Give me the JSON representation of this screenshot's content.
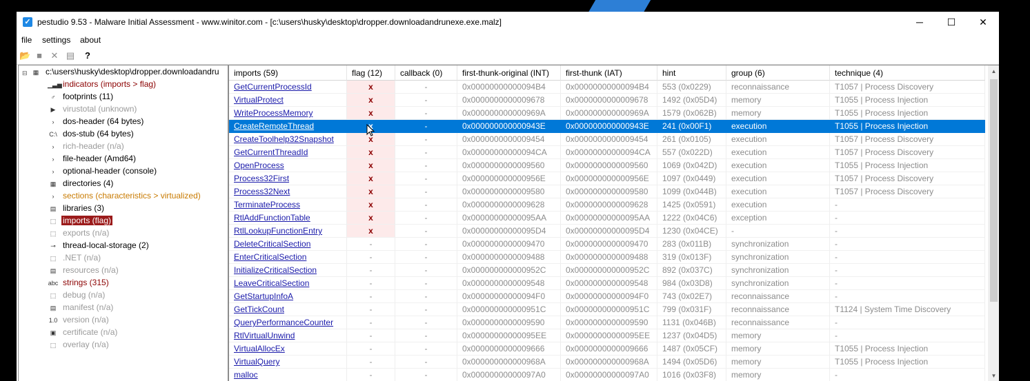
{
  "window": {
    "title": "pestudio 9.53 - Malware Initial Assessment - www.winitor.com - [c:\\users\\husky\\desktop\\dropper.downloadandrunexe.exe.malz]",
    "minimize": "─",
    "maximize": "☐",
    "close": "✕"
  },
  "menu": [
    "file",
    "settings",
    "about"
  ],
  "toolbar": {
    "open_icon": "folder-open-icon",
    "save_icon": "save-icon",
    "close_icon": "close-file-icon",
    "list_icon": "list-icon",
    "help_icon": "help-icon"
  },
  "tree": {
    "root": "c:\\users\\husky\\desktop\\dropper.downloadandru",
    "items": [
      {
        "label": "indicators (imports > flag)",
        "color": "#8b0000",
        "icon": "indicators-icon"
      },
      {
        "label": "footprints (11)",
        "color": "#000000",
        "icon": "footprints-icon"
      },
      {
        "label": "virustotal (unknown)",
        "color": "#9a9a9a",
        "icon": "virustotal-icon"
      },
      {
        "label": "dos-header (64 bytes)",
        "color": "#000000",
        "icon": "expand-arrow-icon"
      },
      {
        "label": "dos-stub (64 bytes)",
        "color": "#000000",
        "icon": "console-icon"
      },
      {
        "label": "rich-header (n/a)",
        "color": "#9a9a9a",
        "icon": "expand-arrow-icon"
      },
      {
        "label": "file-header (Amd64)",
        "color": "#000000",
        "icon": "expand-arrow-icon"
      },
      {
        "label": "optional-header (console)",
        "color": "#000000",
        "icon": "expand-arrow-icon"
      },
      {
        "label": "directories (4)",
        "color": "#000000",
        "icon": "directories-icon"
      },
      {
        "label": "sections (characteristics > virtualized)",
        "color": "#c87a00",
        "icon": "expand-arrow-icon"
      },
      {
        "label": "libraries (3)",
        "color": "#000000",
        "icon": "libraries-icon"
      },
      {
        "label": "imports (flag)",
        "color": "#ffffff",
        "icon": "imports-icon"
      },
      {
        "label": "exports (n/a)",
        "color": "#9a9a9a",
        "icon": "exports-icon"
      },
      {
        "label": "thread-local-storage (2)",
        "color": "#000000",
        "icon": "tls-icon"
      },
      {
        "label": ".NET (n/a)",
        "color": "#9a9a9a",
        "icon": "dotnet-icon"
      },
      {
        "label": "resources (n/a)",
        "color": "#9a9a9a",
        "icon": "resources-icon"
      },
      {
        "label": "strings (315)",
        "color": "#8b0000",
        "icon": "strings-icon"
      },
      {
        "label": "debug (n/a)",
        "color": "#9a9a9a",
        "icon": "debug-icon"
      },
      {
        "label": "manifest (n/a)",
        "color": "#9a9a9a",
        "icon": "manifest-icon"
      },
      {
        "label": "version (n/a)",
        "color": "#9a9a9a",
        "icon": "version-icon"
      },
      {
        "label": "certificate (n/a)",
        "color": "#9a9a9a",
        "icon": "certificate-icon"
      },
      {
        "label": "overlay (n/a)",
        "color": "#9a9a9a",
        "icon": "overlay-icon"
      }
    ]
  },
  "imports": {
    "columns": [
      "imports (59)",
      "flag (12)",
      "callback (0)",
      "first-thunk-original (INT)",
      "first-thunk (IAT)",
      "hint",
      "group (6)",
      "technique (4)"
    ],
    "rows": [
      [
        "GetCurrentProcessId",
        "x",
        "-",
        "0x00000000000094B4",
        "0x00000000000094B4",
        "553 (0x0229)",
        "reconnaissance",
        "T1057 | Process Discovery"
      ],
      [
        "VirtualProtect",
        "x",
        "-",
        "0x0000000000009678",
        "0x0000000000009678",
        "1492 (0x05D4)",
        "memory",
        "T1055 | Process Injection"
      ],
      [
        "WriteProcessMemory",
        "x",
        "-",
        "0x000000000000969A",
        "0x000000000000969A",
        "1579 (0x062B)",
        "memory",
        "T1055 | Process Injection"
      ],
      [
        "CreateRemoteThread",
        "x",
        "-",
        "0x000000000000943E",
        "0x000000000000943E",
        "241 (0x00F1)",
        "execution",
        "T1055 | Process Injection"
      ],
      [
        "CreateToolhelp32Snapshot",
        "x",
        "-",
        "0x0000000000009454",
        "0x0000000000009454",
        "261 (0x0105)",
        "execution",
        "T1057 | Process Discovery"
      ],
      [
        "GetCurrentThreadId",
        "x",
        "-",
        "0x00000000000094CA",
        "0x00000000000094CA",
        "557 (0x022D)",
        "execution",
        "T1057 | Process Discovery"
      ],
      [
        "OpenProcess",
        "x",
        "-",
        "0x0000000000009560",
        "0x0000000000009560",
        "1069 (0x042D)",
        "execution",
        "T1055 | Process Injection"
      ],
      [
        "Process32First",
        "x",
        "-",
        "0x000000000000956E",
        "0x000000000000956E",
        "1097 (0x0449)",
        "execution",
        "T1057 | Process Discovery"
      ],
      [
        "Process32Next",
        "x",
        "-",
        "0x0000000000009580",
        "0x0000000000009580",
        "1099 (0x044B)",
        "execution",
        "T1057 | Process Discovery"
      ],
      [
        "TerminateProcess",
        "x",
        "-",
        "0x0000000000009628",
        "0x0000000000009628",
        "1425 (0x0591)",
        "execution",
        "-"
      ],
      [
        "RtlAddFunctionTable",
        "x",
        "-",
        "0x00000000000095AA",
        "0x00000000000095AA",
        "1222 (0x04C6)",
        "exception",
        "-"
      ],
      [
        "RtlLookupFunctionEntry",
        "x",
        "-",
        "0x00000000000095D4",
        "0x00000000000095D4",
        "1230 (0x04CE)",
        "-",
        "-"
      ],
      [
        "DeleteCriticalSection",
        "-",
        "-",
        "0x0000000000009470",
        "0x0000000000009470",
        "283 (0x011B)",
        "synchronization",
        "-"
      ],
      [
        "EnterCriticalSection",
        "-",
        "-",
        "0x0000000000009488",
        "0x0000000000009488",
        "319 (0x013F)",
        "synchronization",
        "-"
      ],
      [
        "InitializeCriticalSection",
        "-",
        "-",
        "0x000000000000952C",
        "0x000000000000952C",
        "892 (0x037C)",
        "synchronization",
        "-"
      ],
      [
        "LeaveCriticalSection",
        "-",
        "-",
        "0x0000000000009548",
        "0x0000000000009548",
        "984 (0x03D8)",
        "synchronization",
        "-"
      ],
      [
        "GetStartupInfoA",
        "-",
        "-",
        "0x00000000000094F0",
        "0x00000000000094F0",
        "743 (0x02E7)",
        "reconnaissance",
        "-"
      ],
      [
        "GetTickCount",
        "-",
        "-",
        "0x000000000000951C",
        "0x000000000000951C",
        "799 (0x031F)",
        "reconnaissance",
        "T1124 | System Time Discovery"
      ],
      [
        "QueryPerformanceCounter",
        "-",
        "-",
        "0x0000000000009590",
        "0x0000000000009590",
        "1131 (0x046B)",
        "reconnaissance",
        "-"
      ],
      [
        "RtlVirtualUnwind",
        "-",
        "-",
        "0x00000000000095EE",
        "0x00000000000095EE",
        "1237 (0x04D5)",
        "memory",
        "-"
      ],
      [
        "VirtualAllocEx",
        "-",
        "-",
        "0x0000000000009666",
        "0x0000000000009666",
        "1487 (0x05CF)",
        "memory",
        "T1055 | Process Injection"
      ],
      [
        "VirtualQuery",
        "-",
        "-",
        "0x000000000000968A",
        "0x000000000000968A",
        "1494 (0x05D6)",
        "memory",
        "T1055 | Process Injection"
      ],
      [
        "malloc",
        "-",
        "-",
        "0x00000000000097A0",
        "0x00000000000097A0",
        "1016 (0x03F8)",
        "memory",
        "-"
      ]
    ],
    "selected_row": 3
  },
  "colors": {
    "selection": "#0078d7",
    "flag_bg": "#fdeaea",
    "flag_x": "#8b0000",
    "tree_selected": "#9b1b1b"
  }
}
